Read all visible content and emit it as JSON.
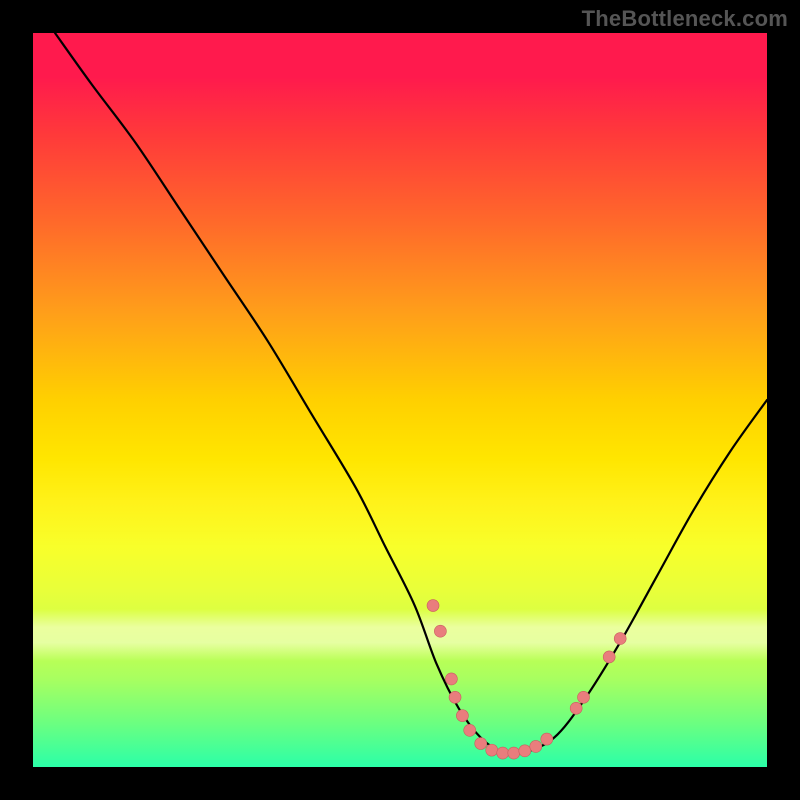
{
  "watermark": "TheBottleneck.com",
  "colors": {
    "dot_fill": "#e97d7d",
    "dot_stroke": "#c95e5e",
    "curve": "#000000",
    "gradient_top": "#ff1a4d",
    "gradient_bottom": "#2bffa8"
  },
  "chart_data": {
    "type": "line",
    "title": "",
    "xlabel": "",
    "ylabel": "",
    "xlim": [
      0,
      100
    ],
    "ylim": [
      0,
      100
    ],
    "grid": false,
    "legend": false,
    "series": [
      {
        "name": "curve",
        "x": [
          3,
          8,
          14,
          20,
          26,
          32,
          38,
          44,
          48,
          52,
          55,
          58,
          61,
          64,
          67,
          71,
          75,
          80,
          85,
          90,
          95,
          100
        ],
        "y": [
          100,
          93,
          85,
          76,
          67,
          58,
          48,
          38,
          30,
          22,
          14,
          8,
          4,
          2,
          2,
          4,
          9,
          17,
          26,
          35,
          43,
          50
        ]
      }
    ],
    "points": [
      {
        "x": 54.5,
        "y": 22.0
      },
      {
        "x": 55.5,
        "y": 18.5
      },
      {
        "x": 57.0,
        "y": 12.0
      },
      {
        "x": 57.5,
        "y": 9.5
      },
      {
        "x": 58.5,
        "y": 7.0
      },
      {
        "x": 59.5,
        "y": 5.0
      },
      {
        "x": 61.0,
        "y": 3.2
      },
      {
        "x": 62.5,
        "y": 2.3
      },
      {
        "x": 64.0,
        "y": 1.9
      },
      {
        "x": 65.5,
        "y": 1.9
      },
      {
        "x": 67.0,
        "y": 2.2
      },
      {
        "x": 68.5,
        "y": 2.8
      },
      {
        "x": 70.0,
        "y": 3.8
      },
      {
        "x": 74.0,
        "y": 8.0
      },
      {
        "x": 75.0,
        "y": 9.5
      },
      {
        "x": 78.5,
        "y": 15.0
      },
      {
        "x": 80.0,
        "y": 17.5
      }
    ],
    "point_radius": 6
  }
}
